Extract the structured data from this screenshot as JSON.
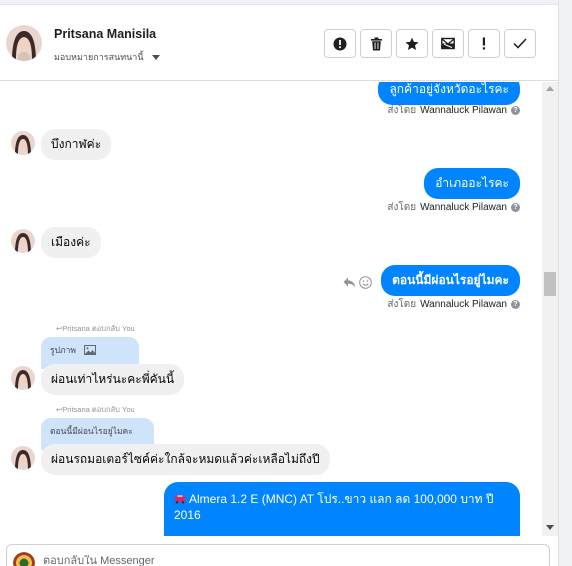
{
  "header": {
    "contact_name": "Pritsana Manisila",
    "assign_label": "มอบหมายการสนทนานี้",
    "toolbar": [
      {
        "name": "report-button",
        "icon": "alert-circle-icon"
      },
      {
        "name": "delete-button",
        "icon": "trash-icon"
      },
      {
        "name": "star-button",
        "icon": "star-icon"
      },
      {
        "name": "spam-button",
        "icon": "mail-block-icon"
      },
      {
        "name": "mark-important-button",
        "icon": "exclamation-icon"
      },
      {
        "name": "done-button",
        "icon": "check-icon"
      }
    ]
  },
  "messages": {
    "m1": {
      "text": "ลูกค้าอยู่จังหวัดอะไรคะ"
    },
    "m1_sent_prefix": "ส่งโดย",
    "m1_sent_by": "Wannaluck Pilawan",
    "m2": {
      "text": "บึงกาฬค่ะ"
    },
    "m3": {
      "text": "อำเภออะไรคะ"
    },
    "m3_sent_prefix": "ส่งโดย",
    "m3_sent_by": "Wannaluck Pilawan",
    "m4": {
      "text": "เมืองค่ะ"
    },
    "m5": {
      "text": "ตอนนี้มีผ่อนไรอยู่ไมคะ"
    },
    "m5_sent_prefix": "ส่งโดย",
    "m5_sent_by": "Wannaluck Pilawan",
    "r1_note": "↩Pritsana ตอบกลับ You",
    "r1_quote": "รูปภาพ",
    "m6": {
      "text": "ผ่อนเท่าไหร่นะคะพี่คันนี้"
    },
    "r2_note": "↩Pritsana ตอบกลับ You",
    "r2_quote": "ตอนนี้มีผ่อนไรอยู่ไมคะ",
    "m7": {
      "text": "ผ่อนรถมอเตอร์ไซค์ค่ะใกล้จะหมดแล้วค่ะเหลือไม่ถึงปี"
    },
    "m8": {
      "text": "Almera 1.2 E (MNC) AT โปร..ขาว แลก ลด 100,000 บาท ปี 2016",
      "icon": "car-emoji"
    }
  },
  "composer": {
    "placeholder": "ตอบกลับใน Messenger"
  },
  "colors": {
    "outgoing": "#0084ff",
    "incoming": "#f1f0f0",
    "reply_quote": "#cfe3fb"
  }
}
